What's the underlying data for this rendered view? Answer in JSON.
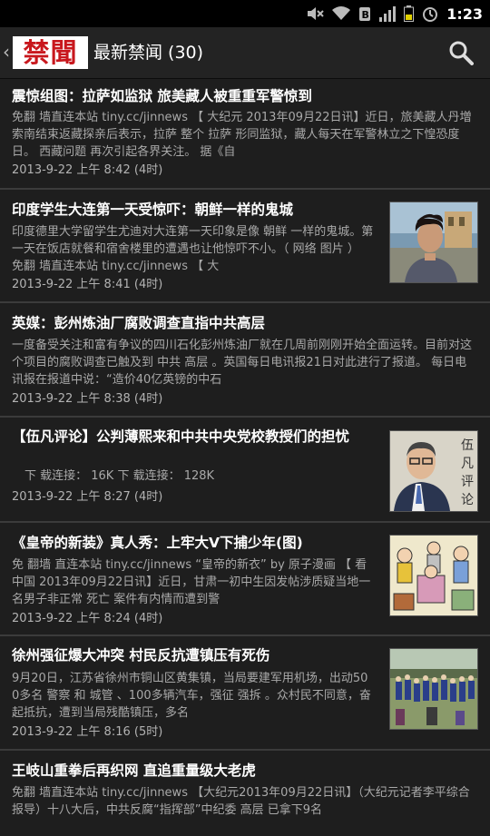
{
  "status": {
    "time": "1:23"
  },
  "header": {
    "logo_text": "禁聞",
    "title": "最新禁闻 (30)"
  },
  "articles": [
    {
      "title": "震惊组图：拉萨如监狱 旅美藏人被重重军警惊到",
      "summary": "免翻 墙直连本站 tiny.cc/jinnews 【 大纪元 2013年09月22日讯】近日，旅美藏人丹増索南结束返藏探亲后表示，拉萨 整个 拉萨 形同监狱，藏人每天在军警林立之下惶恐度日。 西藏问题 再次引起各界关注。 据《自",
      "time": "2013-9-22 上午 8:42 (4时)"
    },
    {
      "title": "印度学生大连第一天受惊吓：朝鲜一样的鬼城",
      "summary": "印度德里大学留学生尤迪对大连第一天印象是像 朝鲜 一样的鬼城。第一天在饭店就餐和宿舍楼里的遭遇也让他惊吓不小。（ 网络 图片 ） 免翻 墙直连本站 tiny.cc/jinnews 【 大",
      "time": "2013-9-22 上午 8:41 (4时)"
    },
    {
      "title": "英媒：彭州炼油厂腐败调查直指中共高层",
      "summary": "一度备受关注和富有争议的四川石化彭州炼油厂就在几周前刚刚开始全面运转。目前对这个项目的腐败调查已触及到 中共 高层 。英国每日电讯报21日对此进行了报道。 每日电讯报在报道中说：“造价40亿英镑的中石",
      "time": "2013-9-22 上午 8:38 (4时)"
    },
    {
      "title": "【伍凡评论】公判薄熙来和中共中央党校教授们的担忧",
      "summary": "下 载连接： 16K 下 载连接： 128K",
      "time": "2013-9-22 上午 8:27 (4时)"
    },
    {
      "title": "《皇帝的新装》真人秀：上牢大V下捕少年(图)",
      "summary": "免 翻墙 直连本站 tiny.cc/jinnews “皇帝的新衣” by 原子漫画 【 看中国 2013年09月22日讯】近日，甘肃一初中生因发帖涉质疑当地一名男子非正常 死亡 案件有内情而遭到警",
      "time": "2013-9-22 上午 8:24 (4时)"
    },
    {
      "title": "徐州强征爆大冲突 村民反抗遭镇压有死伤",
      "summary": "9月20日，江苏省徐州市铜山区黄集镇，当局要建军用机场，出动500多名 警察 和 城管 、100多辆汽车，强征 强拆 。众村民不同意，奋起抵抗，遭到当局残酷镇压，多名",
      "time": "2013-9-22 上午 8:16 (5时)"
    },
    {
      "title": "王岐山重拳后再织网 直追重量级大老虎",
      "summary": "免翻 墙直连本站 tiny.cc/jinnews 【大纪元2013年09月22日讯】（大纪元记者李平综合报导）十八大后，中共反腐“指挥部”中纪委 高层 已拿下9名",
      "time": ""
    }
  ],
  "thumbs": {
    "a1": "portrait-photo",
    "a3": "portrait-calligraphy",
    "a4": "cartoon",
    "a5": "crowd-photo"
  }
}
